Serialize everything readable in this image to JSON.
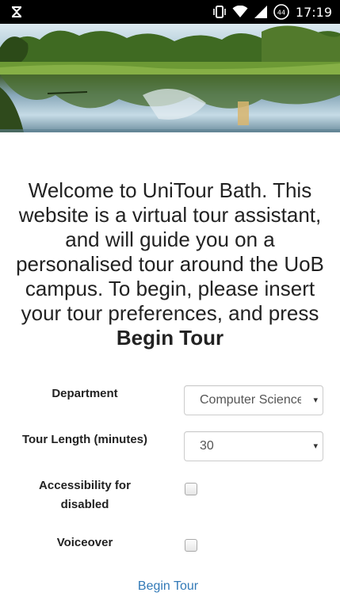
{
  "status_bar": {
    "time": "17:19",
    "icons": [
      "hourglass-icon",
      "vibrate-icon",
      "wifi-icon",
      "cell-signal-icon",
      "battery-icon"
    ],
    "battery_level": "44"
  },
  "hero": {
    "image_name": "lake-landscape-image"
  },
  "intro": {
    "text": "Welcome to UniTour Bath. This website is a virtual tour assistant, and will guide you on a personalised tour around the UoB campus. To begin, please insert your tour preferences, and press ",
    "emphasis": "Begin Tour"
  },
  "form": {
    "department": {
      "label": "Department",
      "selected": "Computer Science"
    },
    "tour_length": {
      "label": "Tour Length (minutes)",
      "selected": "30"
    },
    "accessibility": {
      "label_line1": "Accessibility for",
      "label_line2": "disabled",
      "checked": false
    },
    "voiceover": {
      "label": "Voiceover",
      "checked": false
    },
    "dropdown_arrow": "▾"
  },
  "begin_tour_link": "Begin Tour",
  "colors": {
    "link": "#337ab7",
    "status_bar_bg": "#000000"
  }
}
